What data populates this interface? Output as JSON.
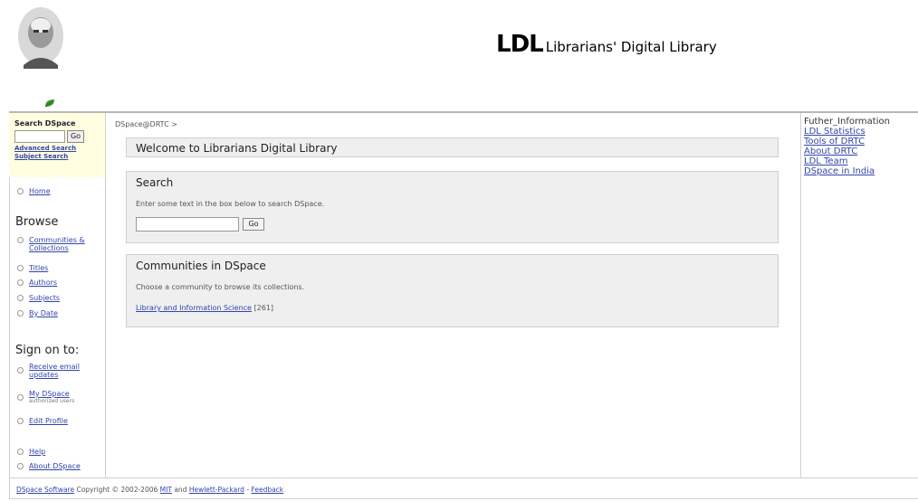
{
  "header": {
    "logo_abbr": "LDL",
    "logo_full": "Librarians' Digital Library"
  },
  "breadcrumb": "DSpace@DRTC >",
  "nav": {
    "search_title": "Search DSpace",
    "go_label": "Go",
    "advanced_search": "Advanced Search",
    "subject_search": "Subject Search",
    "home": "Home",
    "browse_heading": "Browse",
    "browse_items": [
      "Communities & Collections",
      "Titles",
      "Authors",
      "Subjects",
      "By Date"
    ],
    "signon_heading": "Sign on to:",
    "receive_email": "Receive email updates",
    "my_dspace": "My DSpace",
    "my_dspace_note": "authorized users",
    "edit_profile": "Edit Profile",
    "help": "Help",
    "about": "About DSpace"
  },
  "main": {
    "welcome_title": "Welcome to Librarians Digital Library",
    "search_title": "Search",
    "search_text": "Enter some text in the box below to search DSpace.",
    "search_value": "",
    "go_label": "Go",
    "communities_title": "Communities in DSpace",
    "communities_text": "Choose a community to browse its collections.",
    "community_link": "Library and Information Science",
    "community_count": "[261]"
  },
  "right": {
    "title": "Futher_Information",
    "links": [
      "LDL Statistics",
      "Tools of DRTC",
      "About DRTC",
      "LDL Team",
      "DSpace in India"
    ]
  },
  "footer": {
    "software": "DSpace Software",
    "copyright": "Copyright © 2002-2006",
    "mit": "MIT",
    "and": "and",
    "hp": "Hewlett-Packard",
    "sep": "-",
    "feedback": "Feedback"
  }
}
